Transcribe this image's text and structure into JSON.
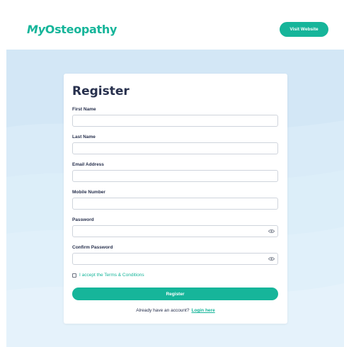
{
  "header": {
    "logo_prefix": "My",
    "logo_rest": "Osteopathy",
    "visit_button": "Visit Website"
  },
  "form": {
    "title": "Register",
    "fields": [
      {
        "label": "First Name",
        "value": ""
      },
      {
        "label": "Last Name",
        "value": ""
      },
      {
        "label": "Email Address",
        "value": ""
      },
      {
        "label": "Mobile Number",
        "value": ""
      },
      {
        "label": "Password",
        "value": ""
      },
      {
        "label": "Confirm Password",
        "value": ""
      }
    ],
    "terms_label": "I accept the Terms & Conditions",
    "terms_checked": false,
    "submit_button": "Register",
    "footer_text": "Already have an account?",
    "login_link": "Login here"
  },
  "colors": {
    "brand": "#16b59a",
    "background": "#d3e7f6",
    "heading": "#27304d"
  },
  "icons": {
    "password_toggle": "eye-icon"
  }
}
